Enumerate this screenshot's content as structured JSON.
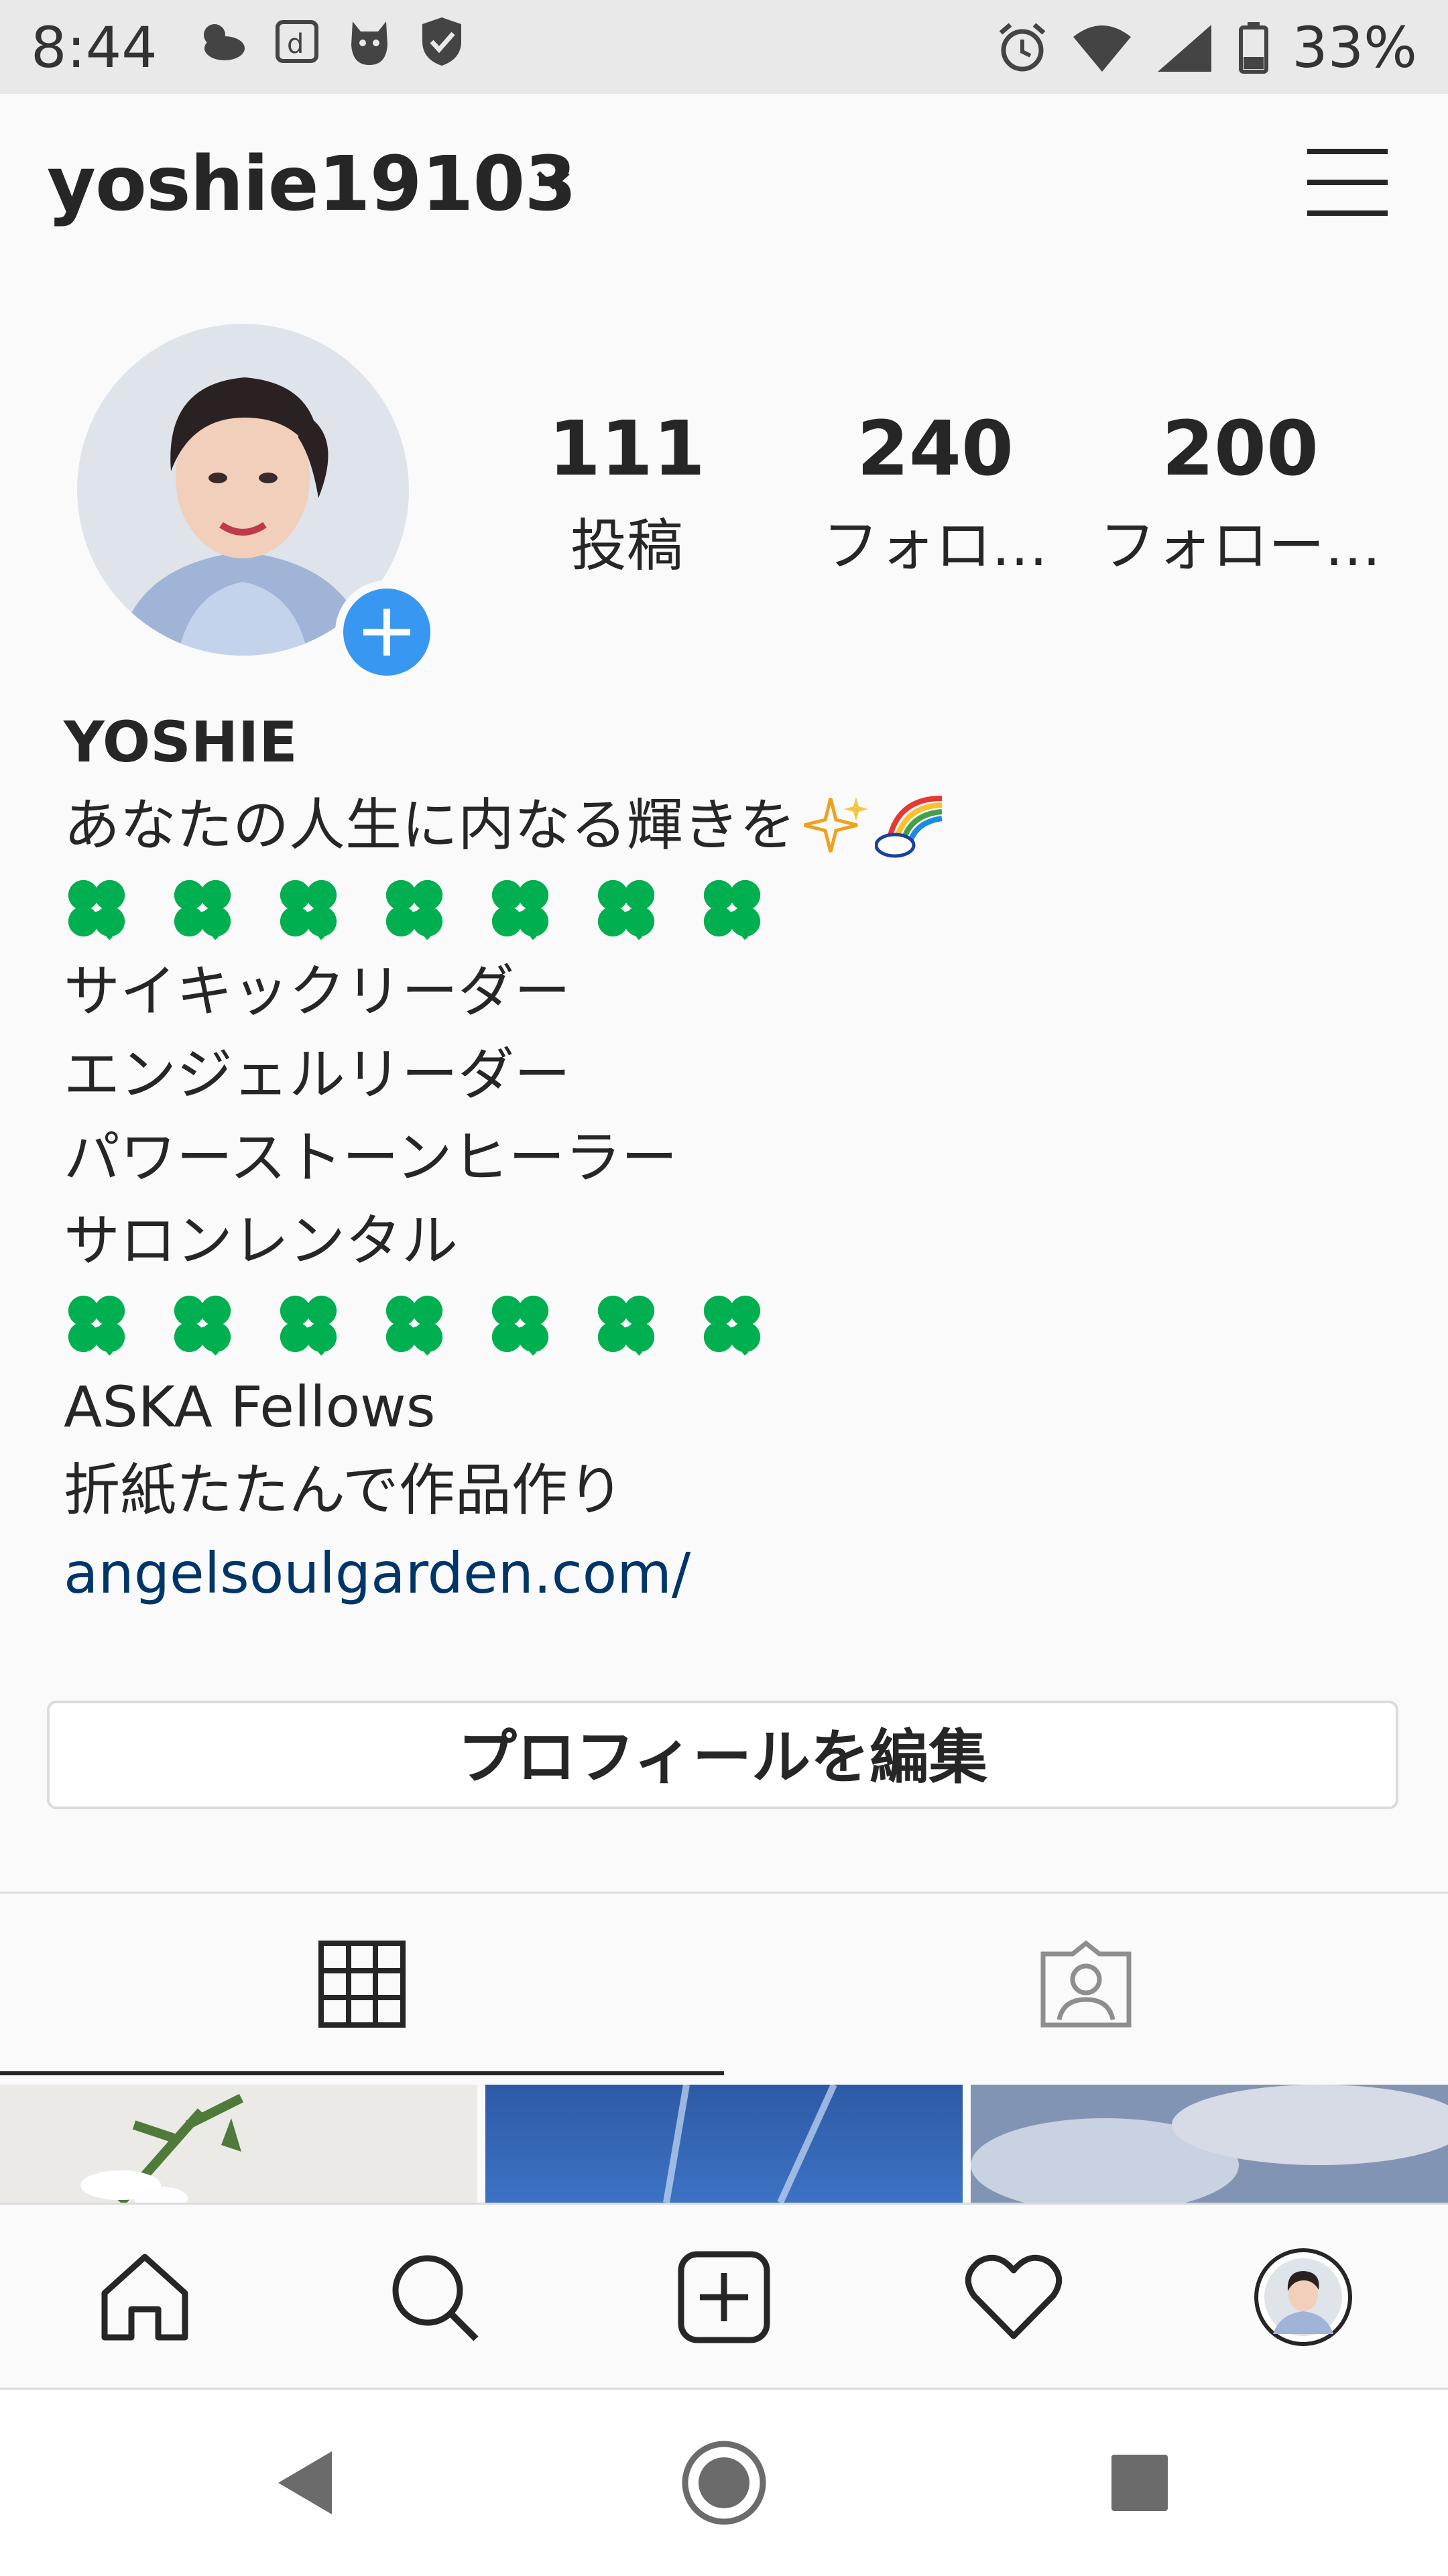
{
  "status_bar": {
    "time": "8:44",
    "battery": "33%",
    "icons_left": [
      "weather-icon",
      "docomo-icon",
      "dog-icon",
      "shield-icon"
    ],
    "icons_right": [
      "alarm-icon",
      "wifi-icon",
      "signal-icon",
      "battery-icon"
    ]
  },
  "header": {
    "username": "yoshie19103"
  },
  "stats": [
    {
      "count": "111",
      "label": "投稿"
    },
    {
      "count": "240",
      "label": "フォロ…"
    },
    {
      "count": "200",
      "label": "フォロー…"
    }
  ],
  "bio": {
    "name": "YOSHIE",
    "tagline": "あなたの人生に内なる輝きを",
    "clover_count": 7,
    "roles": [
      "サイキックリーダー",
      "エンジェルリーダー",
      "パワーストーンヒーラー",
      "サロンレンタル"
    ],
    "fellows": "ASKA Fellows",
    "hobby": "折紙たたんで作品作り",
    "link": "angelsoulgarden.com/"
  },
  "buttons": {
    "edit_profile": "プロフィールを編集"
  },
  "tabs": [
    {
      "name": "grid",
      "active": true
    },
    {
      "name": "tagged",
      "active": false
    }
  ],
  "colors": {
    "accent_blue": "#3897f0",
    "link": "#003569",
    "clover": "#00b050",
    "text": "#262626",
    "divider": "#dbdbdb"
  },
  "bottom_nav": [
    "home-icon",
    "search-icon",
    "new-post-icon",
    "activity-heart-icon",
    "profile-avatar-icon"
  ],
  "system_nav": [
    "back-icon",
    "home-circle-icon",
    "recents-square-icon"
  ]
}
